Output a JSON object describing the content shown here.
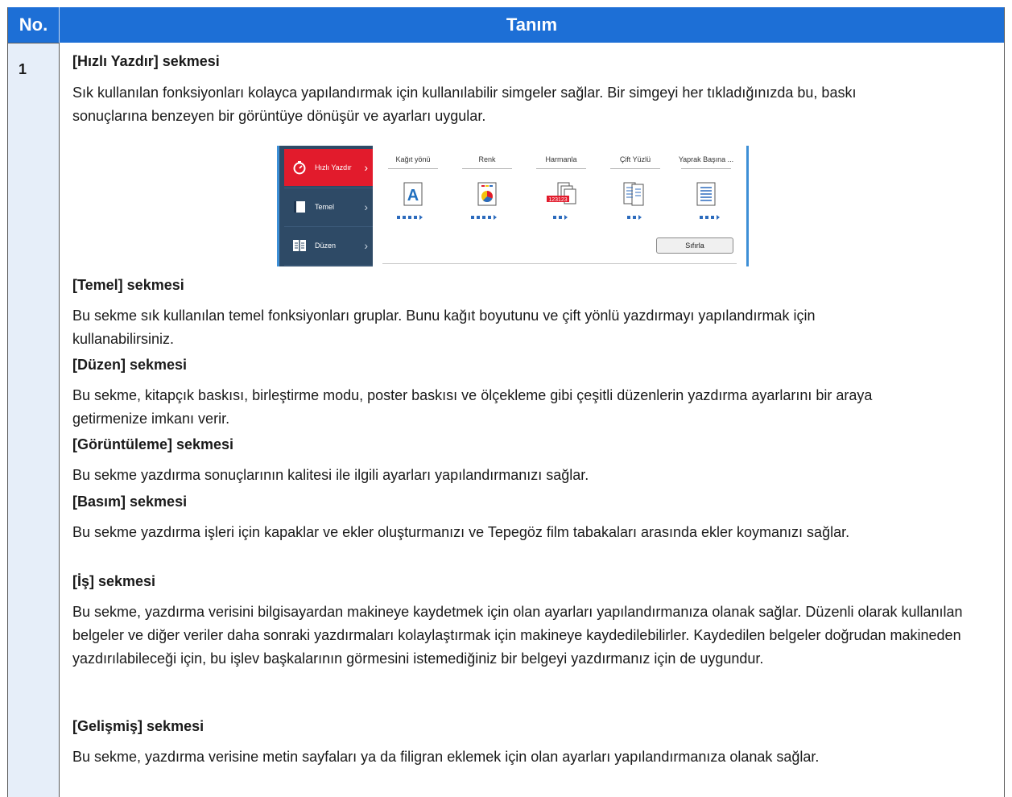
{
  "header": {
    "no_label": "No.",
    "desc_label": "Tanım"
  },
  "row": {
    "number": "1",
    "quick_print": {
      "title": "[Hızlı Yazdır] sekmesi",
      "text": "Sık kullanılan fonksiyonları kolayca yapılandırmak için kullanılabilir simgeler sağlar. Bir simgeyi her tıkladığınızda bu, baskı sonuçlarına benzeyen bir görüntüye dönüşür ve ayarları uygular."
    },
    "basic": {
      "title": "[Temel] sekmesi",
      "text": "Bu sekme sık kullanılan temel fonksiyonları gruplar. Bunu kağıt boyutunu ve çift yönlü yazdırmayı yapılandırmak için kullanabilirsiniz."
    },
    "layout": {
      "title": "[Düzen] sekmesi",
      "text": "Bu sekme, kitapçık baskısı, birleştirme modu, poster baskısı ve ölçekleme gibi çeşitli düzenlerin yazdırma ayarlarını bir araya getirmenize imkanı verir."
    },
    "imaging": {
      "title": "[Görüntüleme] sekmesi",
      "text": "Bu sekme yazdırma sonuçlarının kalitesi ile ilgili ayarları yapılandırmanızı sağlar."
    },
    "publishing": {
      "title": "[Basım] sekmesi",
      "text": "Bu sekme yazdırma işleri için kapaklar ve ekler oluşturmanızı ve Tepegöz film tabakaları arasında ekler koymanızı sağlar."
    },
    "job": {
      "title": "[İş] sekmesi",
      "text": "Bu sekme, yazdırma verisini bilgisayardan makineye kaydetmek için olan ayarları yapılandırmanıza olanak sağlar. Düzenli olarak kullanılan belgeler ve diğer veriler daha sonraki yazdırmaları kolaylaştırmak için makineye kaydedilebilirler. Kaydedilen belgeler doğrudan makineden yazdırılabileceği için, bu işlev başkalarının görmesini istemediğiniz bir belgeyi yazdırmanız için de uygundur."
    },
    "advanced": {
      "title": "[Gelişmiş] sekmesi",
      "text": "Bu sekme, yazdırma verisine metin sayfaları ya da filigran eklemek için olan ayarları yapılandırmanıza olanak sağlar."
    }
  },
  "screenshot": {
    "sidebar": [
      "Hızlı Yazdır",
      "Temel",
      "Düzen"
    ],
    "options": [
      "Kağıt yönü",
      "Renk",
      "Harmanla",
      "Çift Yüzlü",
      "Yaprak Başına ..."
    ],
    "reset_label": "Sıfırla",
    "accent_color": "#e21b2c",
    "sidebar_color": "#2e4a66"
  }
}
